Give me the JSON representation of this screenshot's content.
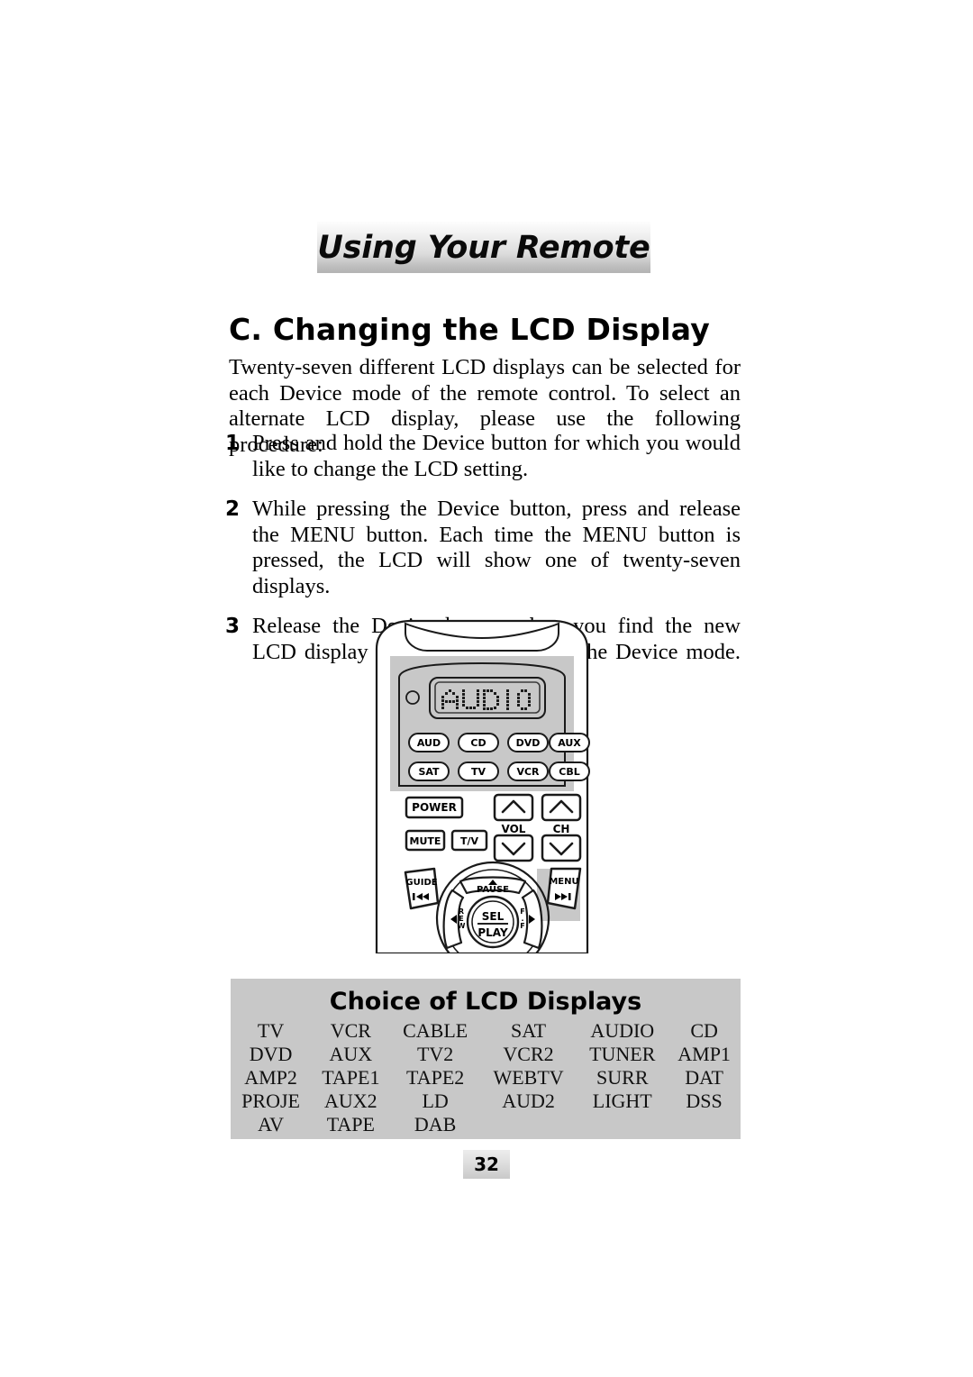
{
  "banner": {
    "title": "Using Your Remote"
  },
  "section": {
    "title": "C. Changing the LCD Display",
    "intro": "Twenty-seven different LCD displays can be selected for each Device mode of the remote control. To select an alternate LCD display, please use the following procedure:"
  },
  "steps": [
    {
      "number": "1",
      "text": "Press and hold the Device button for which you would like to change the LCD setting."
    },
    {
      "number": "2",
      "text": "While pressing the Device button, press and release the MENU button. Each time the MENU button is pressed, the LCD will show one of twenty-seven displays."
    },
    {
      "number": "3",
      "text": "Release the Device button when you find the new LCD display you wish to assign to the Device mode."
    }
  ],
  "remote": {
    "lcd_text": "AUDIO",
    "device_buttons_row1": [
      "AUD",
      "CD",
      "DVD",
      "AUX"
    ],
    "device_buttons_row2": [
      "SAT",
      "TV",
      "VCR",
      "CBL"
    ],
    "power_label": "POWER",
    "mute_label": "MUTE",
    "tv_label": "T/V",
    "vol_label": "VOL",
    "ch_label": "CH",
    "guide_label": "GUIDE",
    "menu_label": "MENU",
    "pause_label": "PAUSE",
    "rew_label": "REW",
    "ff_label": "F.F",
    "sel_label": "SEL",
    "play_label": "PLAY",
    "highlight_color": "#c8c8c8",
    "body_color": "#c8c8c8"
  },
  "lcd_choices": {
    "title": "Choice of LCD Displays",
    "rows": [
      [
        "TV",
        "VCR",
        "CABLE",
        "SAT",
        "AUDIO",
        "CD"
      ],
      [
        "DVD",
        "AUX",
        "TV2",
        "VCR2",
        "TUNER",
        "AMP1"
      ],
      [
        "AMP2",
        "TAPE1",
        "TAPE2",
        "WEBTV",
        "SURR",
        "DAT"
      ],
      [
        "PROJE",
        "AUX2",
        "LD",
        "AUD2",
        "LIGHT",
        "DSS"
      ],
      [
        "AV",
        "TAPE",
        "DAB",
        "",
        "",
        ""
      ]
    ]
  },
  "footer": {
    "page_number": "32"
  }
}
